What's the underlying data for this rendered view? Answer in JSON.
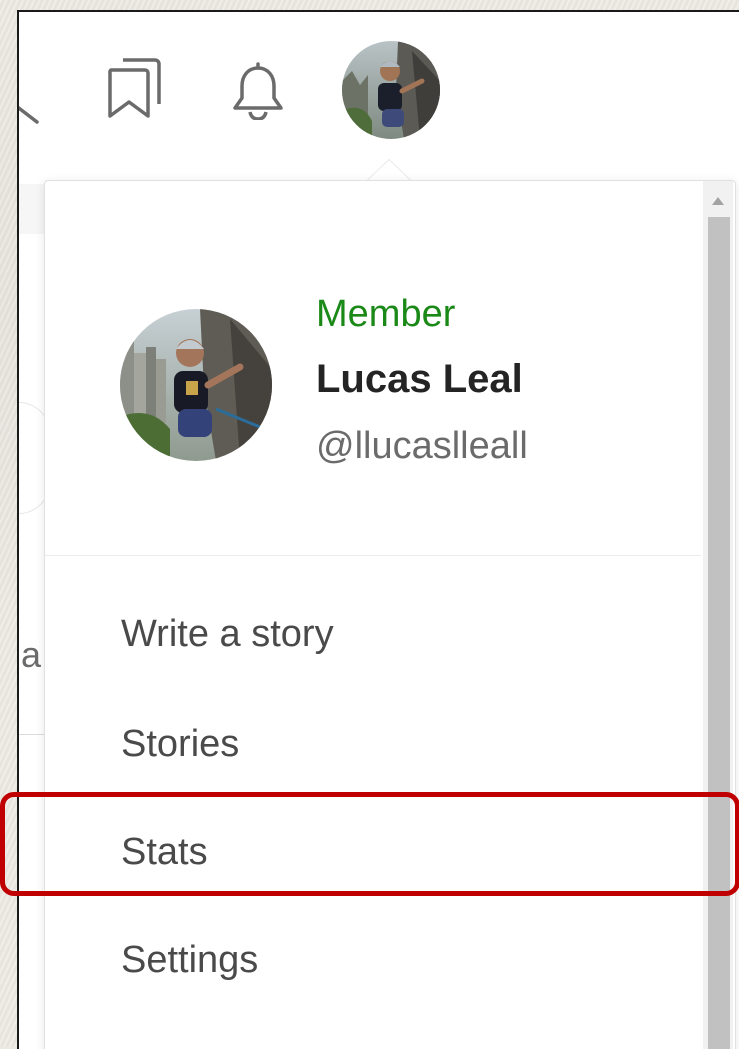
{
  "profile": {
    "status": "Member",
    "name": "Lucas Leal",
    "handle": "@llucaslleall"
  },
  "menu": {
    "items": [
      {
        "label": "Write a story"
      },
      {
        "label": "Stories"
      },
      {
        "label": "Stats"
      },
      {
        "label": "Settings"
      }
    ],
    "highlighted": "Stats"
  },
  "background": {
    "partial_letter": "a"
  },
  "colors": {
    "member_green": "#1a8917",
    "highlight_red": "#c00000",
    "text_dark": "#242424",
    "text_gray": "#6b6b6b"
  },
  "icons": [
    "search-icon",
    "bookmarks-icon",
    "bell-icon",
    "avatar"
  ]
}
